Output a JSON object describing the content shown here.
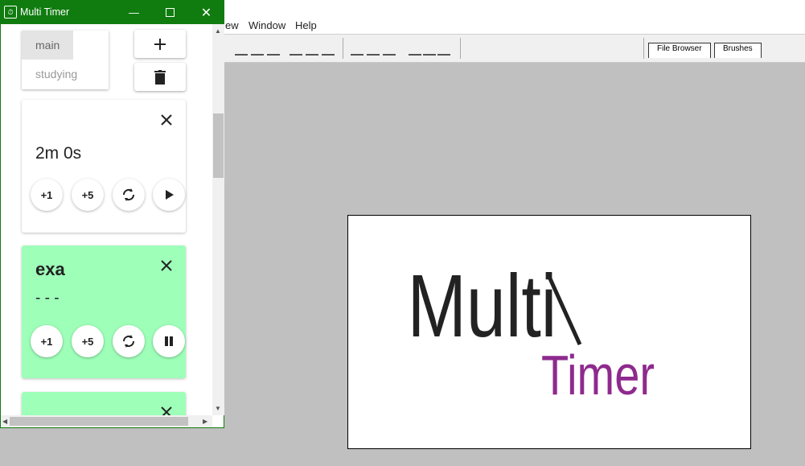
{
  "background_app": {
    "menu": [
      "ew",
      "Window",
      "Help"
    ],
    "tabs": [
      "File Browser",
      "Brushes"
    ]
  },
  "window": {
    "title": "Multi Timer",
    "controls": {
      "minimize": "minimize-icon",
      "maximize": "maximize-icon",
      "close": "close-icon"
    }
  },
  "lists": {
    "items": [
      "main",
      "studying"
    ],
    "selected": "main"
  },
  "actions": {
    "add_icon": "plus-icon",
    "delete_icon": "trash-icon"
  },
  "timers": [
    {
      "title": "",
      "time": "2m 0s",
      "buttons": [
        "+1",
        "+5"
      ],
      "state_icon": "play-icon",
      "color": "#ffffff"
    },
    {
      "title": "exa",
      "time": "- - -",
      "buttons": [
        "+1",
        "+5"
      ],
      "state_icon": "pause-icon",
      "color": "#9effb9"
    },
    {
      "title": "",
      "time": "",
      "color": "#9effb9"
    }
  ],
  "logo": {
    "line1": "Multi",
    "line2": "Timer",
    "color1": "#222222",
    "color2": "#8e2a8e"
  }
}
